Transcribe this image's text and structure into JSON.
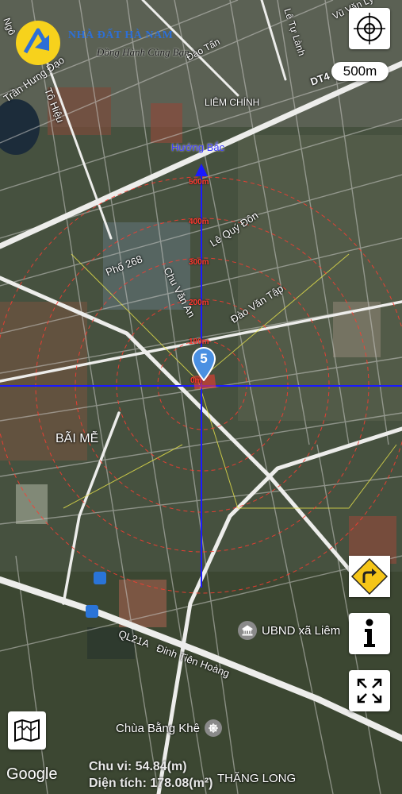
{
  "branding": {
    "logo_name": "Nhà Đất Hà Nam",
    "logo_text": "NHÀ ĐẤT HÀ NAM",
    "tagline": "Đồng Hành Cùng Bạn"
  },
  "map": {
    "scale_label": "500m",
    "google_logo": "Google",
    "grid_label": "Hướng Bắc",
    "ring_labels": [
      "500m",
      "400m",
      "300m",
      "200m",
      "100m",
      "0m"
    ],
    "pin_number": "5",
    "place_labels": {
      "tran_hung_dao": "Trần Hưng Đạo",
      "to_hieu": "Tô Hiệu",
      "dao_tan": "Đào Tấn",
      "liem_chinh": "LIÊM CHÍNH",
      "le_quy_don": "Lê Quý Đôn",
      "pho_268": "Phố 268",
      "chu_van_an": "Chu Văn An",
      "dao_van_tap": "Đào Văn Tập",
      "bai_me": "BÃI MỄ",
      "ql21a": "QL21A",
      "dinh_tien_hoang": "Đinh Tiên Hoàng",
      "ubnd": "UBND xã Liêm",
      "chua_bang_khe": "Chùa Bằng Khê",
      "thang_long": "THĂNG LONG",
      "top_left_fragment": "Ngô",
      "top_right_fragment": "Lê Tự Lành",
      "dt_fragment": "DT4",
      "right_edge_fragment": "Vũ Văn Lý"
    }
  },
  "measure": {
    "perimeter": "Chu vi: 54.84(m)",
    "area": "Diện tích: 178.08(m²)"
  },
  "controls": {
    "target_icon": "crosshair-icon",
    "directions_icon": "turn-right-icon",
    "info_icon": "info-icon",
    "fullscreen_icon": "fullscreen-icon",
    "map_layers_icon": "folded-map-icon"
  },
  "colors": {
    "grid_line": "#1a1aff",
    "ring": "#ff3b30",
    "roads": "#e9e9e9",
    "satellite_base": "#3f4a39",
    "logo_yellow": "#f7d21c",
    "logo_blue": "#2d6fd6",
    "diamond_sign": "#f5c518"
  }
}
